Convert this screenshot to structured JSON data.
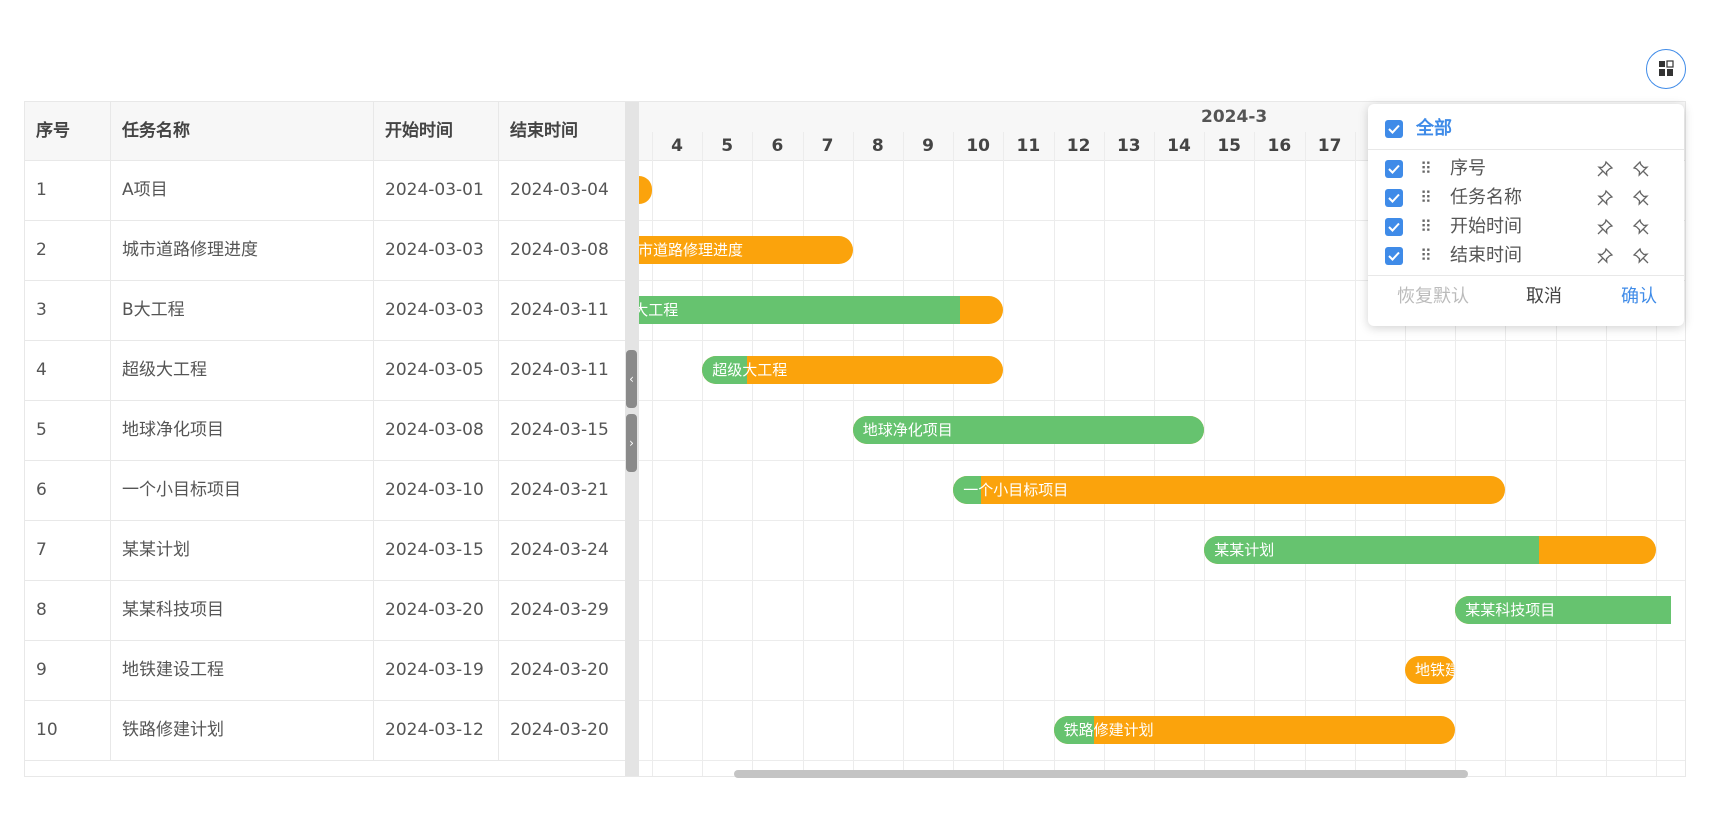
{
  "table": {
    "headers": [
      "序号",
      "任务名称",
      "开始时间",
      "结束时间"
    ],
    "rows": [
      {
        "id": "1",
        "name": "A项目",
        "start": "2024-03-01",
        "end": "2024-03-04"
      },
      {
        "id": "2",
        "name": "城市道路修理进度",
        "start": "2024-03-03",
        "end": "2024-03-08"
      },
      {
        "id": "3",
        "name": "B大工程",
        "start": "2024-03-03",
        "end": "2024-03-11"
      },
      {
        "id": "4",
        "name": "超级大工程",
        "start": "2024-03-05",
        "end": "2024-03-11"
      },
      {
        "id": "5",
        "name": "地球净化项目",
        "start": "2024-03-08",
        "end": "2024-03-15"
      },
      {
        "id": "6",
        "name": "一个小目标项目",
        "start": "2024-03-10",
        "end": "2024-03-21"
      },
      {
        "id": "7",
        "name": "某某计划",
        "start": "2024-03-15",
        "end": "2024-03-24"
      },
      {
        "id": "8",
        "name": "某某科技项目",
        "start": "2024-03-20",
        "end": "2024-03-29"
      },
      {
        "id": "9",
        "name": "地铁建设工程",
        "start": "2024-03-19",
        "end": "2024-03-20"
      },
      {
        "id": "10",
        "name": "铁路修建计划",
        "start": "2024-03-12",
        "end": "2024-03-20"
      }
    ]
  },
  "gantt": {
    "month": "2024-3",
    "days": [
      "4",
      "5",
      "6",
      "7",
      "8",
      "9",
      "10",
      "11",
      "12",
      "13",
      "14",
      "15",
      "16",
      "17"
    ],
    "bars": [
      {
        "label": "",
        "progress": 0.0
      },
      {
        "label": "城市道路修理进度",
        "progress": 0.0
      },
      {
        "label": "B大工程",
        "progress": 0.88
      },
      {
        "label": "超级大工程",
        "progress": 0.15
      },
      {
        "label": "地球净化项目",
        "progress": 1.0
      },
      {
        "label": "一个小目标项目",
        "progress": 0.05
      },
      {
        "label": "某某计划",
        "progress": 0.74
      },
      {
        "label": "某某科技项目",
        "progress": 1.0
      },
      {
        "label": "地铁建设...",
        "progress": 0.0
      },
      {
        "label": "铁路修建计划",
        "progress": 0.1
      }
    ],
    "colors": {
      "bar": "#fba30c",
      "progress": "#66c36f"
    }
  },
  "column_settings": {
    "all_label": "全部",
    "columns": [
      {
        "label": "序号",
        "checked": true
      },
      {
        "label": "任务名称",
        "checked": true
      },
      {
        "label": "开始时间",
        "checked": true
      },
      {
        "label": "结束时间",
        "checked": true
      }
    ],
    "reset_label": "恢复默认",
    "cancel_label": "取消",
    "confirm_label": "确认"
  },
  "icons": {
    "settings": "layout-grid-icon",
    "checkbox": "check-icon",
    "drag": "drag-handle-icon",
    "pin": "pin-icon"
  },
  "accent": "#3f8be8"
}
